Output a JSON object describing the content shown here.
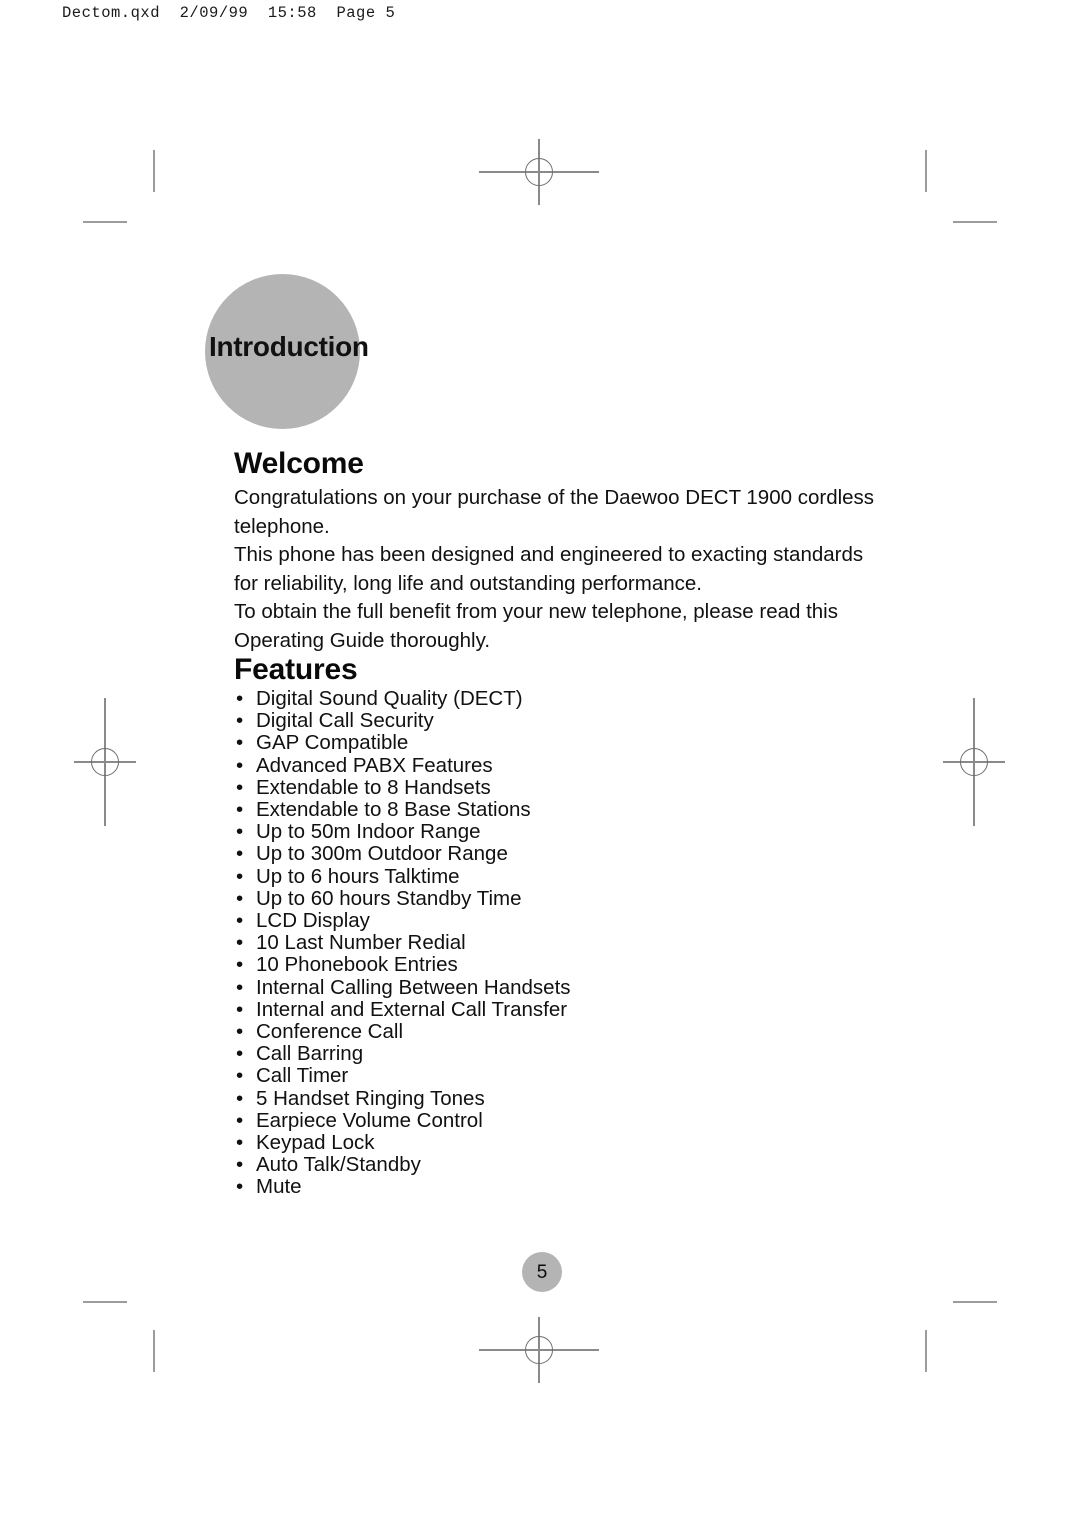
{
  "scan_header": "Dectom.qxd  2/09/99  15:58  Page 5",
  "tab": {
    "label": "Introduction",
    "color": "#b4b4b4"
  },
  "welcome": {
    "heading": "Welcome",
    "paragraphs": [
      "Congratulations on your purchase of the Daewoo DECT 1900 cordless telephone.",
      "This phone has been designed and engineered to exacting standards for reliability, long life and outstanding performance.",
      "To obtain the full benefit from your new telephone, please read this Operating Guide thoroughly."
    ]
  },
  "features": {
    "heading": "Features",
    "bullet_glyph": "•",
    "items": [
      "Digital Sound Quality (DECT)",
      "Digital Call Security",
      "GAP Compatible",
      "Advanced PABX Features",
      "Extendable to 8 Handsets",
      "Extendable to 8 Base Stations",
      "Up to 50m Indoor Range",
      "Up to 300m Outdoor Range",
      "Up to 6 hours Talktime",
      "Up to 60 hours Standby Time",
      "LCD Display",
      "10 Last Number Redial",
      "10 Phonebook Entries",
      "Internal Calling Between Handsets",
      "Internal and External Call Transfer",
      "Conference Call",
      "Call Barring",
      "Call Timer",
      "5 Handset Ringing Tones",
      "Earpiece Volume Control",
      "Keypad Lock",
      "Auto Talk/Standby",
      "Mute"
    ]
  },
  "page_number": "5"
}
